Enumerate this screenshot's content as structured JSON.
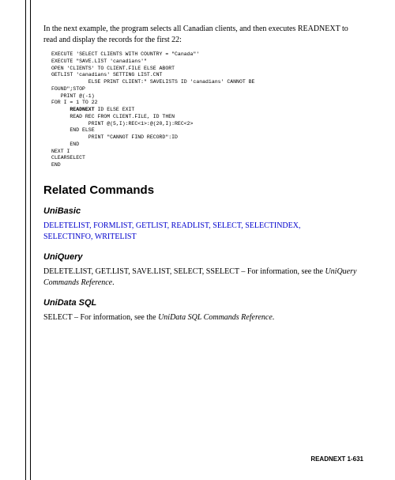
{
  "intro": "In the next example, the program selects all Canadian clients, and then executes READNEXT to read and display the records for the first 22:",
  "code": {
    "lines": [
      {
        "indent": 0,
        "text": "EXECUTE 'SELECT CLIENTS WITH COUNTRY = \"Canada\"'",
        "bold": false
      },
      {
        "indent": 0,
        "text": "EXECUTE \"SAVE.LIST 'canadians'\"",
        "bold": false
      },
      {
        "indent": 0,
        "text": "OPEN 'CLIENTS' TO CLIENT.FILE ELSE ABORT",
        "bold": false
      },
      {
        "indent": 0,
        "text": "GETLIST 'canadians' SETTING LIST.CNT",
        "bold": false
      },
      {
        "indent": 12,
        "text": "ELSE PRINT CLIENT:\" SAVELISTS ID 'canadians' CANNOT BE",
        "bold": false
      },
      {
        "indent": -5,
        "text": "FOUND\";STOP",
        "bold": false
      },
      {
        "indent": 3,
        "text": "PRINT @(-1)",
        "bold": false
      },
      {
        "indent": 0,
        "text": "FOR I = 1 TO 22",
        "bold": false
      },
      {
        "indent": 6,
        "text": "READNEXT",
        "bold": true,
        "suffix": " ID ELSE EXIT"
      },
      {
        "indent": 6,
        "text": "READ REC FROM CLIENT.FILE, ID THEN",
        "bold": false
      },
      {
        "indent": 12,
        "text": "PRINT @(5,I):REC<1>:@(20,I):REC<2>",
        "bold": false
      },
      {
        "indent": 6,
        "text": "END ELSE",
        "bold": false
      },
      {
        "indent": 12,
        "text": "PRINT \"CANNOT FIND RECORD\":ID",
        "bold": false
      },
      {
        "indent": 6,
        "text": "END",
        "bold": false
      },
      {
        "indent": 0,
        "text": "NEXT I",
        "bold": false
      },
      {
        "indent": 0,
        "text": "CLEARSELECT",
        "bold": false
      },
      {
        "indent": 0,
        "text": "END",
        "bold": false
      }
    ]
  },
  "relatedHeading": "Related Commands",
  "unibasic": {
    "heading": "UniBasic",
    "links": [
      "DELETELIST",
      "FORMLIST",
      "GETLIST",
      "READLIST",
      "SELECT",
      "SELECTINDEX",
      "SELECTINFO",
      "WRITELIST"
    ]
  },
  "uniquery": {
    "heading": "UniQuery",
    "textPrefix": "DELETE.LIST, GET.LIST, SAVE.LIST, SELECT, SSELECT – For information, see the ",
    "italicRef": "UniQuery Commands Reference",
    "textSuffix": "."
  },
  "unidatasql": {
    "heading": "UniData SQL",
    "textPrefix": "SELECT – For information, see the ",
    "italicRef": "UniData SQL Commands Reference",
    "textSuffix": "."
  },
  "footer": "READNEXT  1-631"
}
